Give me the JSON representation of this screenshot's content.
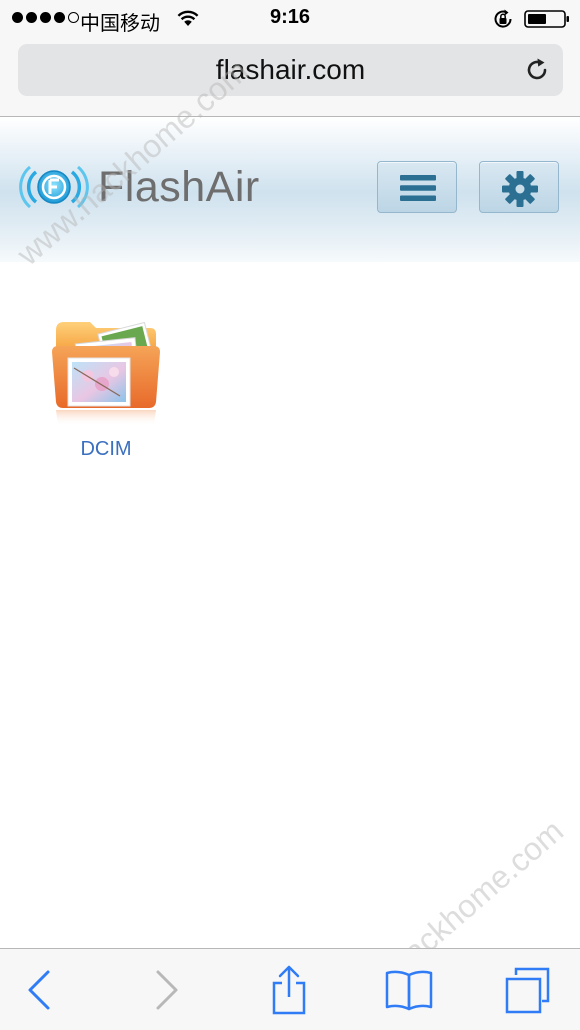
{
  "status_bar": {
    "carrier": "中国移动",
    "time": "9:16",
    "icons": [
      "signal-dots",
      "wifi-icon",
      "rotation-lock-icon",
      "battery-icon"
    ]
  },
  "browser": {
    "url": "flashair.com",
    "reload_icon": "reload-icon"
  },
  "app_header": {
    "logo_text": "FlashAir",
    "menu_icon": "menu-icon",
    "settings_icon": "gear-icon",
    "accent_color": "#2b6f93"
  },
  "files": [
    {
      "name": "DCIM",
      "icon": "photo-folder-icon"
    }
  ],
  "toolbar": {
    "items": [
      "back-icon",
      "forward-icon",
      "share-icon",
      "bookmarks-icon",
      "tabs-icon"
    ],
    "active_color": "#2f7cf6",
    "disabled_color": "#b8b8b8"
  },
  "watermark": {
    "text": "www.hackhome.com"
  }
}
